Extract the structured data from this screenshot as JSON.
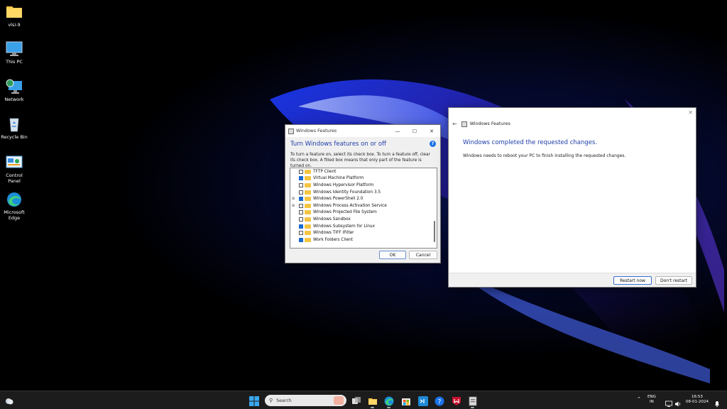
{
  "desktop": {
    "icons": [
      {
        "label": "vlsi-9",
        "icon": "folder-icon"
      },
      {
        "label": "This PC",
        "icon": "monitor-icon"
      },
      {
        "label": "Network",
        "icon": "network-icon"
      },
      {
        "label": "Recycle Bin",
        "icon": "recycle-bin-icon"
      },
      {
        "label": "Control Panel",
        "icon": "control-panel-icon"
      },
      {
        "label": "Microsoft Edge",
        "icon": "edge-icon"
      }
    ]
  },
  "features_dialog": {
    "title": "Windows Features",
    "heading": "Turn Windows features on or off",
    "description": "To turn a feature on, select its check box. To turn a feature off, clear its check box. A filled box means that only part of the feature is turned on.",
    "items": [
      {
        "label": "TFTP Client",
        "checked": false,
        "expandable": false
      },
      {
        "label": "Virtual Machine Platform",
        "checked": true,
        "expandable": false
      },
      {
        "label": "Windows Hypervisor Platform",
        "checked": false,
        "expandable": false
      },
      {
        "label": "Windows Identity Foundation 3.5",
        "checked": false,
        "expandable": false
      },
      {
        "label": "Windows PowerShell 2.0",
        "checked": true,
        "expandable": true
      },
      {
        "label": "Windows Process Activation Service",
        "checked": false,
        "expandable": true
      },
      {
        "label": "Windows Projected File System",
        "checked": false,
        "expandable": false
      },
      {
        "label": "Windows Sandbox",
        "checked": false,
        "expandable": false
      },
      {
        "label": "Windows Subsystem for Linux",
        "checked": true,
        "expandable": false
      },
      {
        "label": "Windows TIFF IFilter",
        "checked": false,
        "expandable": false
      },
      {
        "label": "Work Folders Client",
        "checked": true,
        "expandable": false
      }
    ],
    "ok_label": "OK",
    "cancel_label": "Cancel"
  },
  "completed_dialog": {
    "title": "Windows Features",
    "heading": "Windows completed the requested changes.",
    "message": "Windows needs to reboot your PC to finish installing the requested changes.",
    "restart_label": "Restart now",
    "dont_restart_label": "Don't restart"
  },
  "taskbar": {
    "search_placeholder": "Search",
    "language": "ENG",
    "region": "IN",
    "time": "16:53",
    "date": "08-01-2024"
  },
  "colors": {
    "accent": "#1e3ea8",
    "checkbox_on": "#1a6ad0",
    "taskbar_bg": "#1c1c1c"
  }
}
